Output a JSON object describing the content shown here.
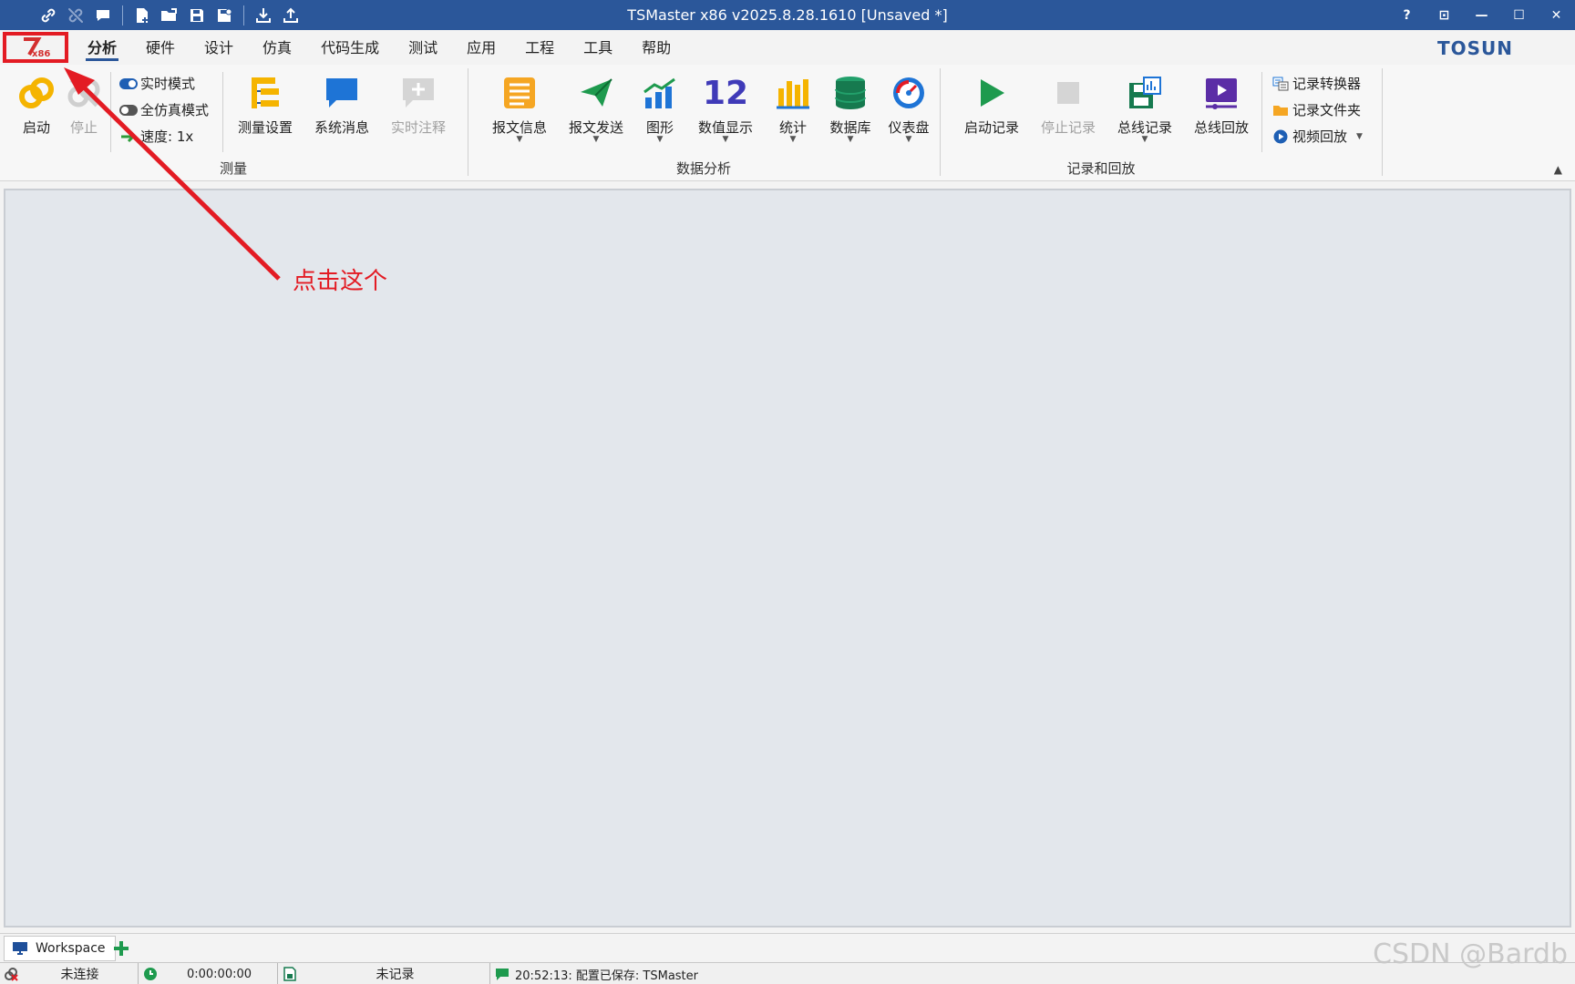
{
  "window": {
    "title": "TSMaster x86 v2025.8.28.1610 [Unsaved *]",
    "controls": [
      "?",
      "⊡",
      "—",
      "☐",
      "✕"
    ]
  },
  "quick_access": [
    "link-icon",
    "unlink-icon",
    "message-icon",
    "new-file-icon",
    "open-folder-icon",
    "save-icon",
    "save-as-icon",
    "import-icon",
    "export-icon"
  ],
  "menu": {
    "logo_text": "x86",
    "tabs": [
      "分析",
      "硬件",
      "设计",
      "仿真",
      "代码生成",
      "测试",
      "应用",
      "工程",
      "工具",
      "帮助"
    ],
    "active_tab": "分析",
    "brand": "TOSUN"
  },
  "ribbon": {
    "measure": {
      "label": "测量",
      "start": "启动",
      "stop": "停止",
      "realtime_mode": "实时模式",
      "full_sim_mode": "全仿真模式",
      "speed": "速度: 1x",
      "measure_setup": "测量设置",
      "system_msg": "系统消息",
      "realtime_note": "实时注释"
    },
    "analysis": {
      "label": "数据分析",
      "msg_info": "报文信息",
      "msg_send": "报文发送",
      "graphics": "图形",
      "numeric_icon": "12",
      "numeric": "数值显示",
      "stats": "统计",
      "database": "数据库",
      "dashboard": "仪表盘"
    },
    "record": {
      "label": "记录和回放",
      "start_rec": "启动记录",
      "stop_rec": "停止记录",
      "bus_rec": "总线记录",
      "bus_replay": "总线回放",
      "converter": "记录转换器",
      "folder": "记录文件夹",
      "video_replay": "视频回放"
    }
  },
  "annotation": {
    "text": "点击这个",
    "color": "#e31b23"
  },
  "doc_tabs": {
    "workspace": "Workspace"
  },
  "status": {
    "connection": "未连接",
    "time": "0:00:00:00",
    "recording": "未记录",
    "message": "20:52:13: 配置已保存: TSMaster"
  },
  "watermark": "CSDN @Bardb",
  "colors": {
    "title_bar": "#2b579a",
    "workspace_bg": "#e3e7ec",
    "accent_red": "#e31b23"
  }
}
